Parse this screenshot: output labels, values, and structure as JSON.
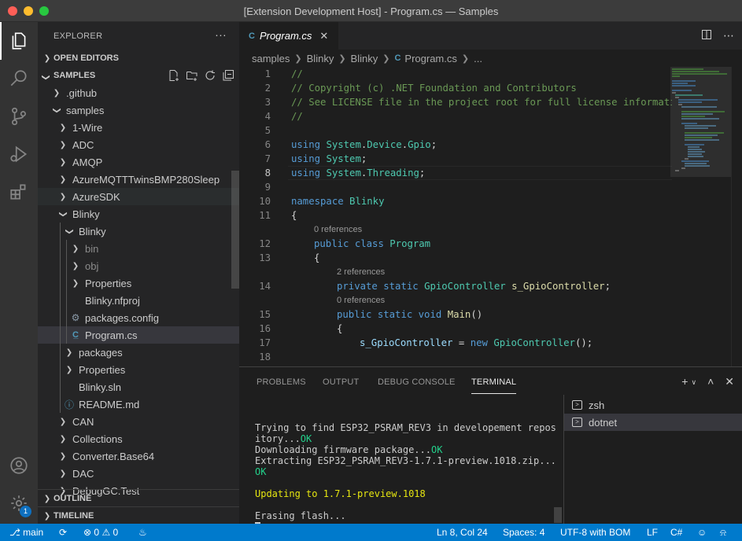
{
  "window": {
    "title": "[Extension Development Host] - Program.cs — Samples"
  },
  "activity": {
    "badge": "1"
  },
  "sidebar": {
    "title": "EXPLORER",
    "more": "···",
    "open_editors": "OPEN EDITORS",
    "workspace": "SAMPLES",
    "outline": "OUTLINE",
    "timeline": "TIMELINE",
    "tree": [
      {
        "label": ".github",
        "icon": "chevron-right"
      },
      {
        "label": "samples",
        "icon": "chevron-down"
      },
      {
        "label": "1-Wire",
        "icon": "chevron-right"
      },
      {
        "label": "ADC",
        "icon": "chevron-right"
      },
      {
        "label": "AMQP",
        "icon": "chevron-right"
      },
      {
        "label": "AzureMQTTTwinsBMP280Sleep",
        "icon": "chevron-right"
      },
      {
        "label": "AzureSDK",
        "icon": "chevron-right"
      },
      {
        "label": "Blinky",
        "icon": "chevron-down"
      },
      {
        "label": "Blinky",
        "icon": "chevron-down"
      },
      {
        "label": "bin",
        "icon": "chevron-right"
      },
      {
        "label": "obj",
        "icon": "chevron-right"
      },
      {
        "label": "Properties",
        "icon": "chevron-right"
      },
      {
        "label": "Blinky.nfproj",
        "icon": "file"
      },
      {
        "label": "packages.config",
        "icon": "gear"
      },
      {
        "label": "Program.cs",
        "icon": "csharp"
      },
      {
        "label": "packages",
        "icon": "chevron-right"
      },
      {
        "label": "Properties",
        "icon": "chevron-right"
      },
      {
        "label": "Blinky.sln",
        "icon": "file"
      },
      {
        "label": "README.md",
        "icon": "info"
      },
      {
        "label": "CAN",
        "icon": "chevron-right"
      },
      {
        "label": "Collections",
        "icon": "chevron-right"
      },
      {
        "label": "Converter.Base64",
        "icon": "chevron-right"
      },
      {
        "label": "DAC",
        "icon": "chevron-right"
      },
      {
        "label": "DebugGC.Test",
        "icon": "chevron-right"
      }
    ]
  },
  "editor": {
    "tab": {
      "label": "Program.cs",
      "icon": "C"
    },
    "breadcrumb": [
      "samples",
      "Blinky",
      "Blinky",
      "Program.cs",
      "..."
    ],
    "code": {
      "l1": "//",
      "l2": "// Copyright (c) .NET Foundation and Contributors",
      "l3": "// See LICENSE file in the project root for full license information.",
      "l4": "//",
      "l6_kw": "using",
      "l6_ns": "System",
      "l6_ns2": "Device",
      "l6_ns3": "Gpio",
      "l7_kw": "using",
      "l7_ns": "System",
      "l8_kw": "using",
      "l8_ns": "System",
      "l8_ns2": "Threading",
      "l10_kw": "namespace",
      "l10_name": "Blinky",
      "lens1": "0 references",
      "l12_kw1": "public",
      "l12_kw2": "class",
      "l12_name": "Program",
      "lens2": "2 references",
      "l14_kw1": "private",
      "l14_kw2": "static",
      "l14_type": "GpioController",
      "l14_var": "s_GpioController",
      "lens3": "0 references",
      "l15_kw1": "public",
      "l15_kw2": "static",
      "l15_kw3": "void",
      "l15_fn": "Main",
      "l17_var": "s_GpioController",
      "l17_kw": "new",
      "l17_type": "GpioController"
    },
    "line_numbers": [
      "1",
      "2",
      "3",
      "4",
      "5",
      "6",
      "7",
      "8",
      "9",
      "10",
      "11",
      "12",
      "13",
      "14",
      "15",
      "16",
      "17",
      "18"
    ]
  },
  "panel": {
    "tabs": [
      "PROBLEMS",
      "OUTPUT",
      "DEBUG CONSOLE",
      "TERMINAL"
    ],
    "terminal": {
      "line1": "Trying to find ESP32_PSRAM_REV3 in developement repos",
      "line2a": "itory...",
      "line2b": "OK",
      "line3a": "Downloading firmware package...",
      "line3b": "OK",
      "line4": "Extracting ESP32_PSRAM_REV3-1.7.1-preview.1018.zip...",
      "line5": "OK",
      "line6": "Updating to 1.7.1-preview.1018",
      "line7": "Erasing flash..."
    },
    "terminals": [
      "zsh",
      "dotnet"
    ]
  },
  "status": {
    "branch": "main",
    "errors": "0",
    "warnings": "0",
    "position": "Ln 8, Col 24",
    "spaces": "Spaces: 4",
    "encoding": "UTF-8 with BOM",
    "eol": "LF",
    "language": "C#"
  },
  "colors": {
    "statusbar": "#007acc",
    "accent": "#0e70c0",
    "ok": "#23d18b",
    "warn": "#e5e510"
  }
}
